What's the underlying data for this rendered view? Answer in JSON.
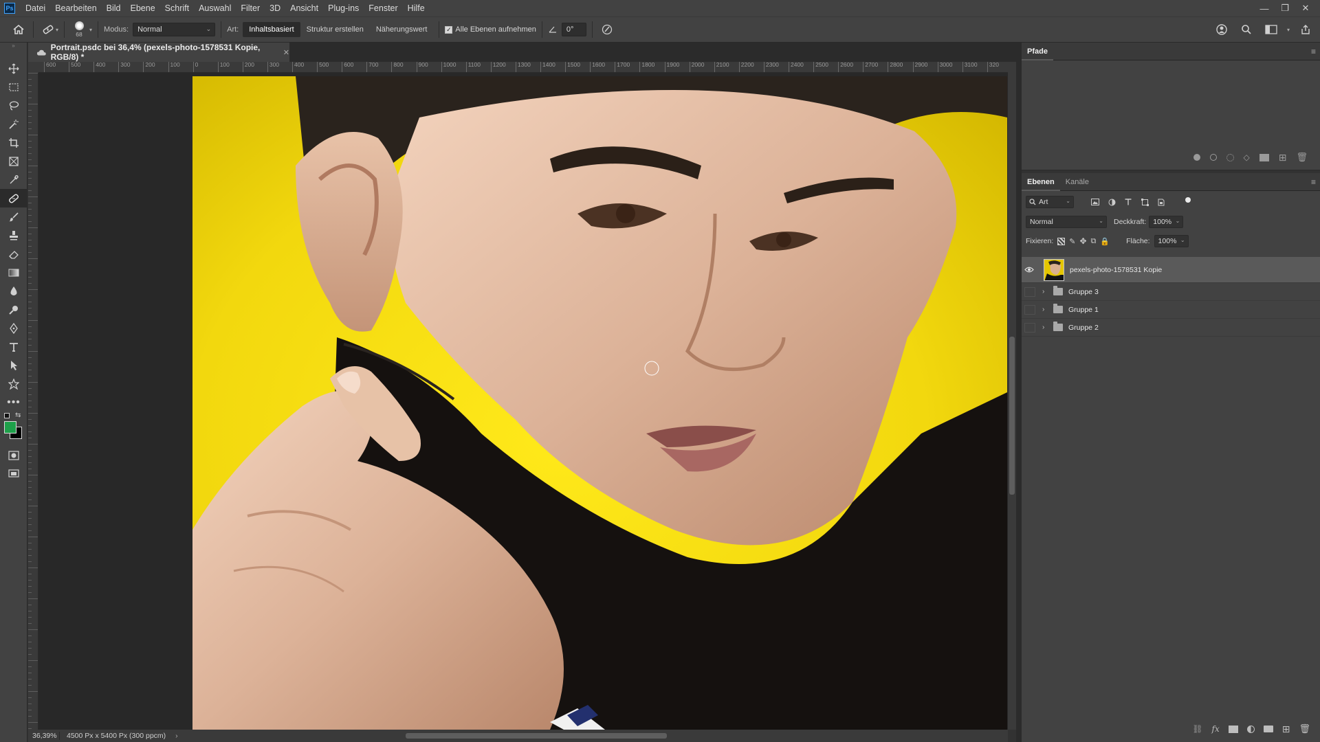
{
  "app": {
    "logo": "Ps",
    "menu": [
      "Datei",
      "Bearbeiten",
      "Bild",
      "Ebene",
      "Schrift",
      "Auswahl",
      "Filter",
      "3D",
      "Ansicht",
      "Plug-ins",
      "Fenster",
      "Hilfe"
    ],
    "window_controls": [
      "—",
      "❐",
      "✕"
    ]
  },
  "options_bar": {
    "brush_size": "68",
    "mode_label": "Modus:",
    "mode_value": "Normal",
    "type_label": "Art:",
    "type_buttons": [
      "Inhaltsbasiert",
      "Struktur erstellen",
      "Näherungswert"
    ],
    "type_active": "Inhaltsbasiert",
    "sample_all_label": "Alle Ebenen aufnehmen",
    "sample_all_checked": true,
    "angle_value": "0°"
  },
  "document": {
    "tab_title": "Portrait.psdc bei 36,4% (pexels-photo-1578531 Kopie, RGB/8) *",
    "ruler_ticks": [
      "600",
      "500",
      "400",
      "300",
      "200",
      "100",
      "0",
      "100",
      "200",
      "300",
      "400",
      "500",
      "600",
      "700",
      "800",
      "900",
      "1000",
      "1100",
      "1200",
      "1300",
      "1400",
      "1500",
      "1600",
      "1700",
      "1800",
      "1900",
      "2000",
      "2100",
      "2200",
      "2300",
      "2400",
      "2500",
      "2600",
      "2700",
      "2800",
      "2900",
      "3000",
      "3100",
      "320"
    ]
  },
  "status": {
    "zoom": "36,39%",
    "doc_info": "4500 Px x 5400 Px (300 ppcm)"
  },
  "paths_panel": {
    "tab": "Pfade"
  },
  "layers_panel": {
    "tabs": [
      "Ebenen",
      "Kanäle"
    ],
    "filter_kind": "Art",
    "blend_mode": "Normal",
    "opacity_label": "Deckkraft:",
    "opacity_value": "100%",
    "lock_label": "Fixieren:",
    "fill_label": "Fläche:",
    "fill_value": "100%",
    "layers": [
      {
        "name": "pexels-photo-1578531 Kopie",
        "type": "pixel",
        "selected": true,
        "visible": true
      },
      {
        "name": "Gruppe 3",
        "type": "group",
        "selected": false,
        "visible": false
      },
      {
        "name": "Gruppe 1",
        "type": "group",
        "selected": false,
        "visible": false
      },
      {
        "name": "Gruppe 2",
        "type": "group",
        "selected": false,
        "visible": false
      }
    ]
  },
  "colors": {
    "foreground": "#1ea04a",
    "background": "#000000",
    "photo_background": "#f2dd10"
  }
}
